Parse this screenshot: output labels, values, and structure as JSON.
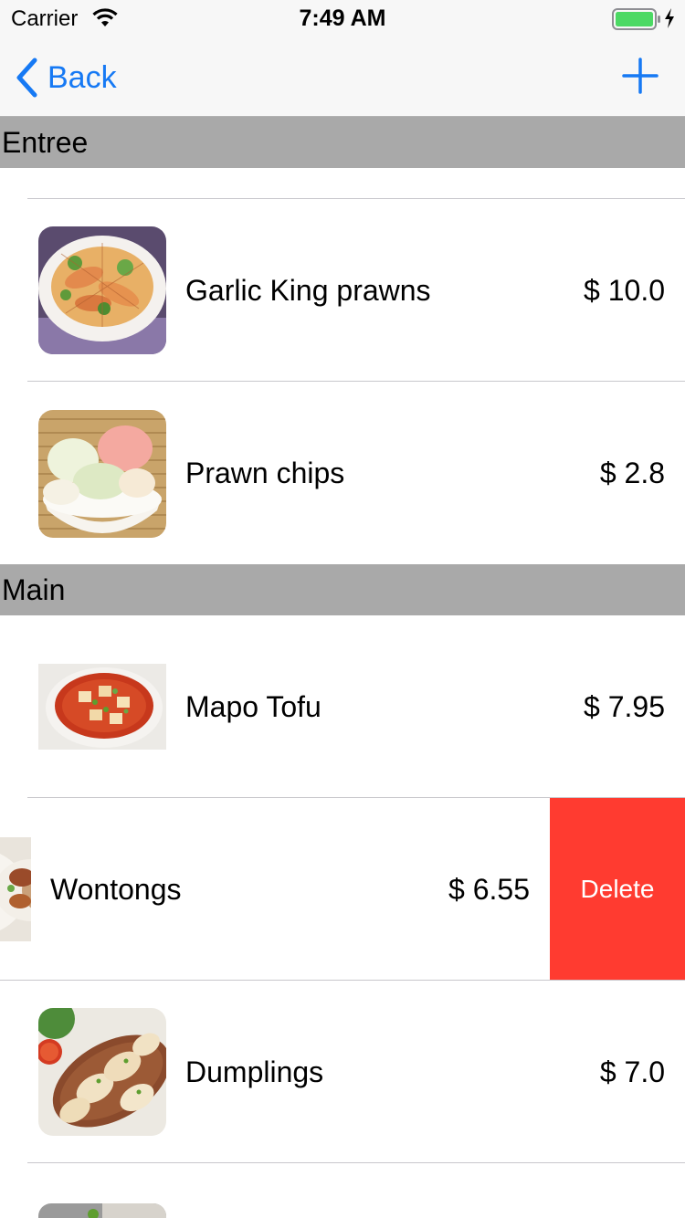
{
  "status_bar": {
    "carrier": "Carrier",
    "time": "7:49 AM"
  },
  "nav": {
    "back_label": "Back"
  },
  "sections": [
    {
      "title": "Entree",
      "items": [
        {
          "name": "Garlic King prawns",
          "price": "$ 10.0",
          "image": "prawns-dish"
        },
        {
          "name": "Prawn chips",
          "price": "$ 2.8",
          "image": "prawn-chips-bowl"
        }
      ]
    },
    {
      "title": "Main",
      "items": [
        {
          "name": "Mapo Tofu",
          "price": "$ 7.95",
          "image": "mapo-tofu-dish"
        },
        {
          "name": "Wontongs",
          "price": "$ 6.55",
          "image": "wonton-dish",
          "swipe_action": "Delete"
        },
        {
          "name": "Dumplings",
          "price": "$ 7.0",
          "image": "dumplings-plate"
        }
      ]
    }
  ],
  "colors": {
    "tint": "#1679f4",
    "section_header": "#a9a9a9",
    "delete": "#ff3b30",
    "battery": "#4cd964"
  }
}
